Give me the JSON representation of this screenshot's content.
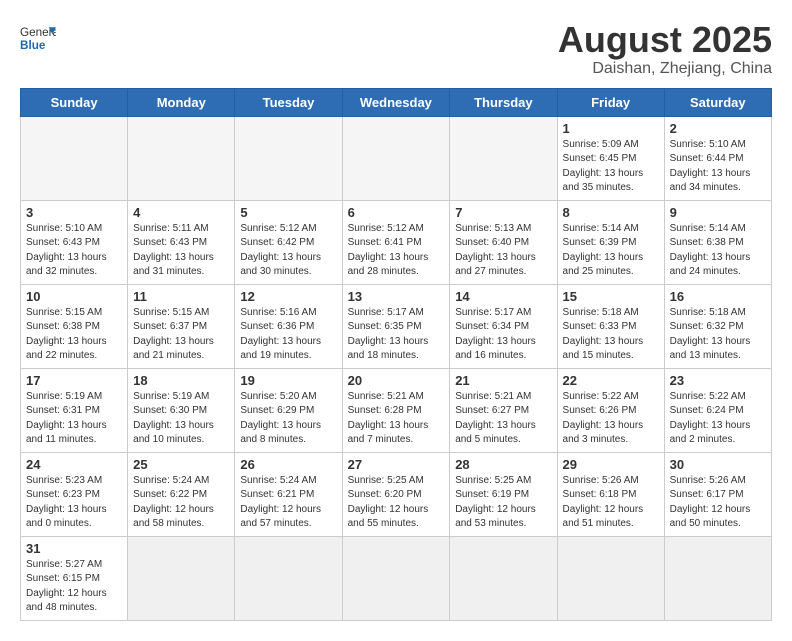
{
  "logo": {
    "text_general": "General",
    "text_blue": "Blue"
  },
  "header": {
    "title": "August 2025",
    "subtitle": "Daishan, Zhejiang, China"
  },
  "weekdays": [
    "Sunday",
    "Monday",
    "Tuesday",
    "Wednesday",
    "Thursday",
    "Friday",
    "Saturday"
  ],
  "weeks": [
    [
      {
        "day": "",
        "info": ""
      },
      {
        "day": "",
        "info": ""
      },
      {
        "day": "",
        "info": ""
      },
      {
        "day": "",
        "info": ""
      },
      {
        "day": "",
        "info": ""
      },
      {
        "day": "1",
        "info": "Sunrise: 5:09 AM\nSunset: 6:45 PM\nDaylight: 13 hours and 35 minutes."
      },
      {
        "day": "2",
        "info": "Sunrise: 5:10 AM\nSunset: 6:44 PM\nDaylight: 13 hours and 34 minutes."
      }
    ],
    [
      {
        "day": "3",
        "info": "Sunrise: 5:10 AM\nSunset: 6:43 PM\nDaylight: 13 hours and 32 minutes."
      },
      {
        "day": "4",
        "info": "Sunrise: 5:11 AM\nSunset: 6:43 PM\nDaylight: 13 hours and 31 minutes."
      },
      {
        "day": "5",
        "info": "Sunrise: 5:12 AM\nSunset: 6:42 PM\nDaylight: 13 hours and 30 minutes."
      },
      {
        "day": "6",
        "info": "Sunrise: 5:12 AM\nSunset: 6:41 PM\nDaylight: 13 hours and 28 minutes."
      },
      {
        "day": "7",
        "info": "Sunrise: 5:13 AM\nSunset: 6:40 PM\nDaylight: 13 hours and 27 minutes."
      },
      {
        "day": "8",
        "info": "Sunrise: 5:14 AM\nSunset: 6:39 PM\nDaylight: 13 hours and 25 minutes."
      },
      {
        "day": "9",
        "info": "Sunrise: 5:14 AM\nSunset: 6:38 PM\nDaylight: 13 hours and 24 minutes."
      }
    ],
    [
      {
        "day": "10",
        "info": "Sunrise: 5:15 AM\nSunset: 6:38 PM\nDaylight: 13 hours and 22 minutes."
      },
      {
        "day": "11",
        "info": "Sunrise: 5:15 AM\nSunset: 6:37 PM\nDaylight: 13 hours and 21 minutes."
      },
      {
        "day": "12",
        "info": "Sunrise: 5:16 AM\nSunset: 6:36 PM\nDaylight: 13 hours and 19 minutes."
      },
      {
        "day": "13",
        "info": "Sunrise: 5:17 AM\nSunset: 6:35 PM\nDaylight: 13 hours and 18 minutes."
      },
      {
        "day": "14",
        "info": "Sunrise: 5:17 AM\nSunset: 6:34 PM\nDaylight: 13 hours and 16 minutes."
      },
      {
        "day": "15",
        "info": "Sunrise: 5:18 AM\nSunset: 6:33 PM\nDaylight: 13 hours and 15 minutes."
      },
      {
        "day": "16",
        "info": "Sunrise: 5:18 AM\nSunset: 6:32 PM\nDaylight: 13 hours and 13 minutes."
      }
    ],
    [
      {
        "day": "17",
        "info": "Sunrise: 5:19 AM\nSunset: 6:31 PM\nDaylight: 13 hours and 11 minutes."
      },
      {
        "day": "18",
        "info": "Sunrise: 5:19 AM\nSunset: 6:30 PM\nDaylight: 13 hours and 10 minutes."
      },
      {
        "day": "19",
        "info": "Sunrise: 5:20 AM\nSunset: 6:29 PM\nDaylight: 13 hours and 8 minutes."
      },
      {
        "day": "20",
        "info": "Sunrise: 5:21 AM\nSunset: 6:28 PM\nDaylight: 13 hours and 7 minutes."
      },
      {
        "day": "21",
        "info": "Sunrise: 5:21 AM\nSunset: 6:27 PM\nDaylight: 13 hours and 5 minutes."
      },
      {
        "day": "22",
        "info": "Sunrise: 5:22 AM\nSunset: 6:26 PM\nDaylight: 13 hours and 3 minutes."
      },
      {
        "day": "23",
        "info": "Sunrise: 5:22 AM\nSunset: 6:24 PM\nDaylight: 13 hours and 2 minutes."
      }
    ],
    [
      {
        "day": "24",
        "info": "Sunrise: 5:23 AM\nSunset: 6:23 PM\nDaylight: 13 hours and 0 minutes."
      },
      {
        "day": "25",
        "info": "Sunrise: 5:24 AM\nSunset: 6:22 PM\nDaylight: 12 hours and 58 minutes."
      },
      {
        "day": "26",
        "info": "Sunrise: 5:24 AM\nSunset: 6:21 PM\nDaylight: 12 hours and 57 minutes."
      },
      {
        "day": "27",
        "info": "Sunrise: 5:25 AM\nSunset: 6:20 PM\nDaylight: 12 hours and 55 minutes."
      },
      {
        "day": "28",
        "info": "Sunrise: 5:25 AM\nSunset: 6:19 PM\nDaylight: 12 hours and 53 minutes."
      },
      {
        "day": "29",
        "info": "Sunrise: 5:26 AM\nSunset: 6:18 PM\nDaylight: 12 hours and 51 minutes."
      },
      {
        "day": "30",
        "info": "Sunrise: 5:26 AM\nSunset: 6:17 PM\nDaylight: 12 hours and 50 minutes."
      }
    ],
    [
      {
        "day": "31",
        "info": "Sunrise: 5:27 AM\nSunset: 6:15 PM\nDaylight: 12 hours and 48 minutes."
      },
      {
        "day": "",
        "info": ""
      },
      {
        "day": "",
        "info": ""
      },
      {
        "day": "",
        "info": ""
      },
      {
        "day": "",
        "info": ""
      },
      {
        "day": "",
        "info": ""
      },
      {
        "day": "",
        "info": ""
      }
    ]
  ]
}
